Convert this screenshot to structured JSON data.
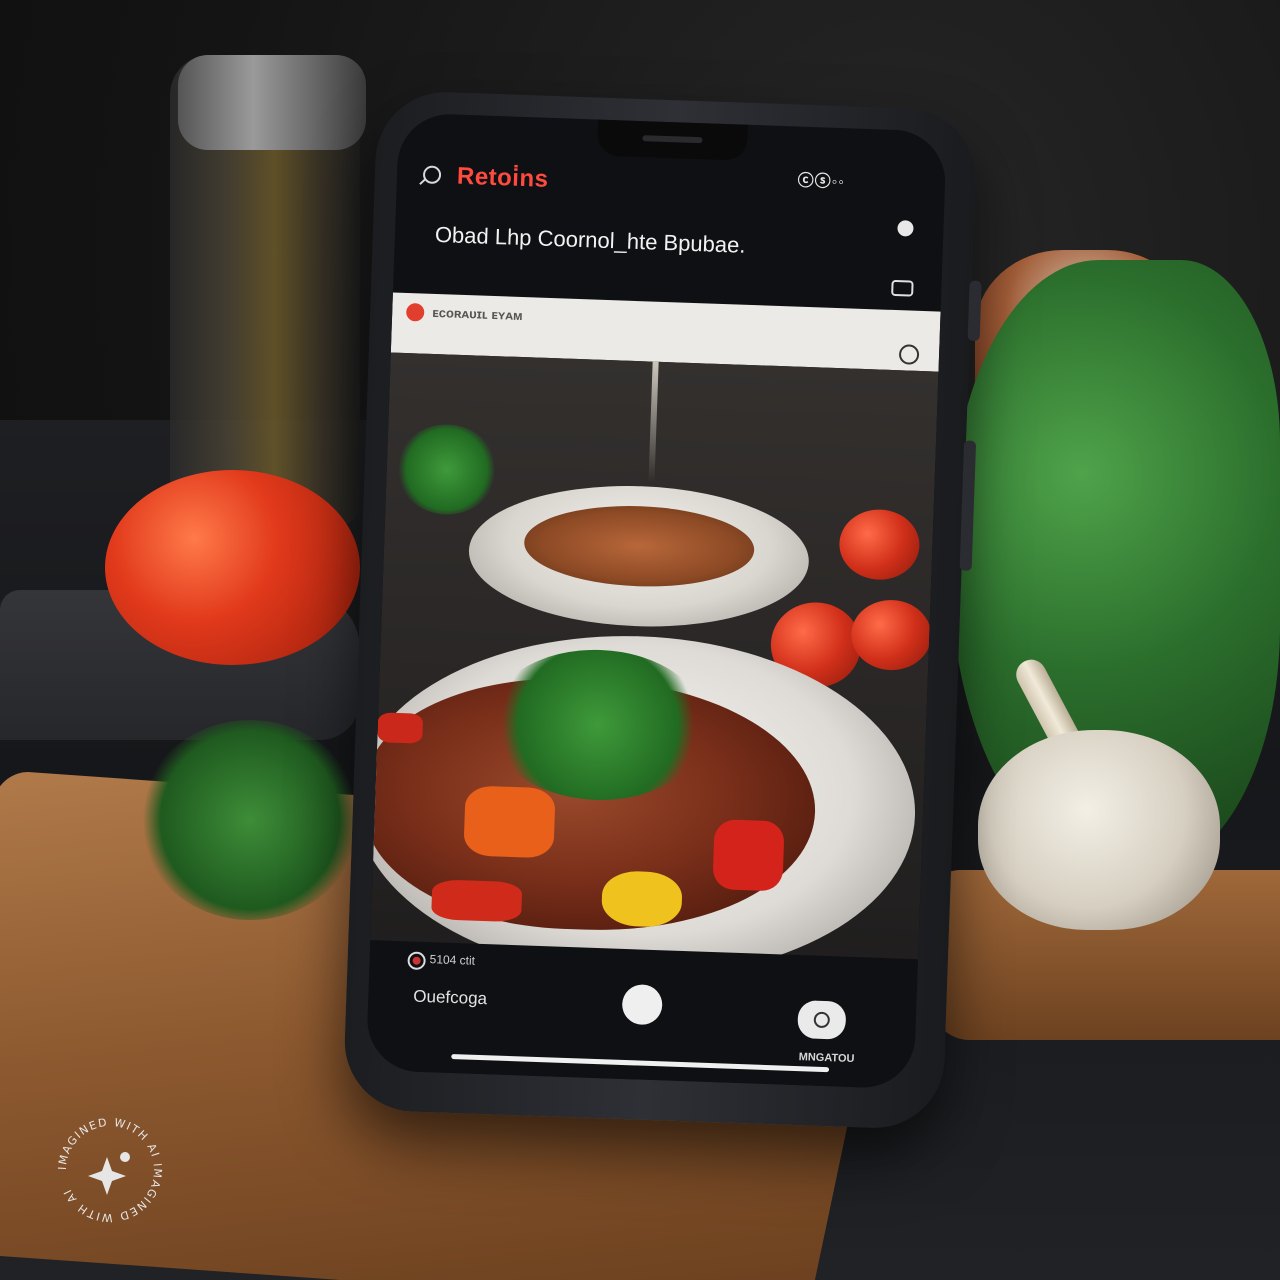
{
  "scene": {
    "description_colors": {
      "tomato": "#e1391b",
      "greens": "#2b6e2c",
      "board": "#8e5a30",
      "background": "#141414"
    }
  },
  "phone": {
    "app_title": "Retoi̇ns",
    "status_icons": "ⓒⓢ◦◦",
    "headline": "Obad Lhp Coornol_hte Bpubae.",
    "banner_text": "ᴇᴄᴏʀᴀᴜɪʟ ᴇʏᴀᴍ",
    "rec_label": "5104 ctit",
    "bottom_left_label": "Ouefcoga",
    "bottom_right_label": "MNGATOU",
    "accent_color": "#ff4a3d",
    "icons": [
      "search-icon",
      "profile-icon",
      "menu-icon",
      "edit-icon",
      "record-icon",
      "shutter-button",
      "camera-toggle"
    ]
  },
  "watermark": {
    "text": "IMAGINED WITH AI IMAGINED WITH AI"
  }
}
